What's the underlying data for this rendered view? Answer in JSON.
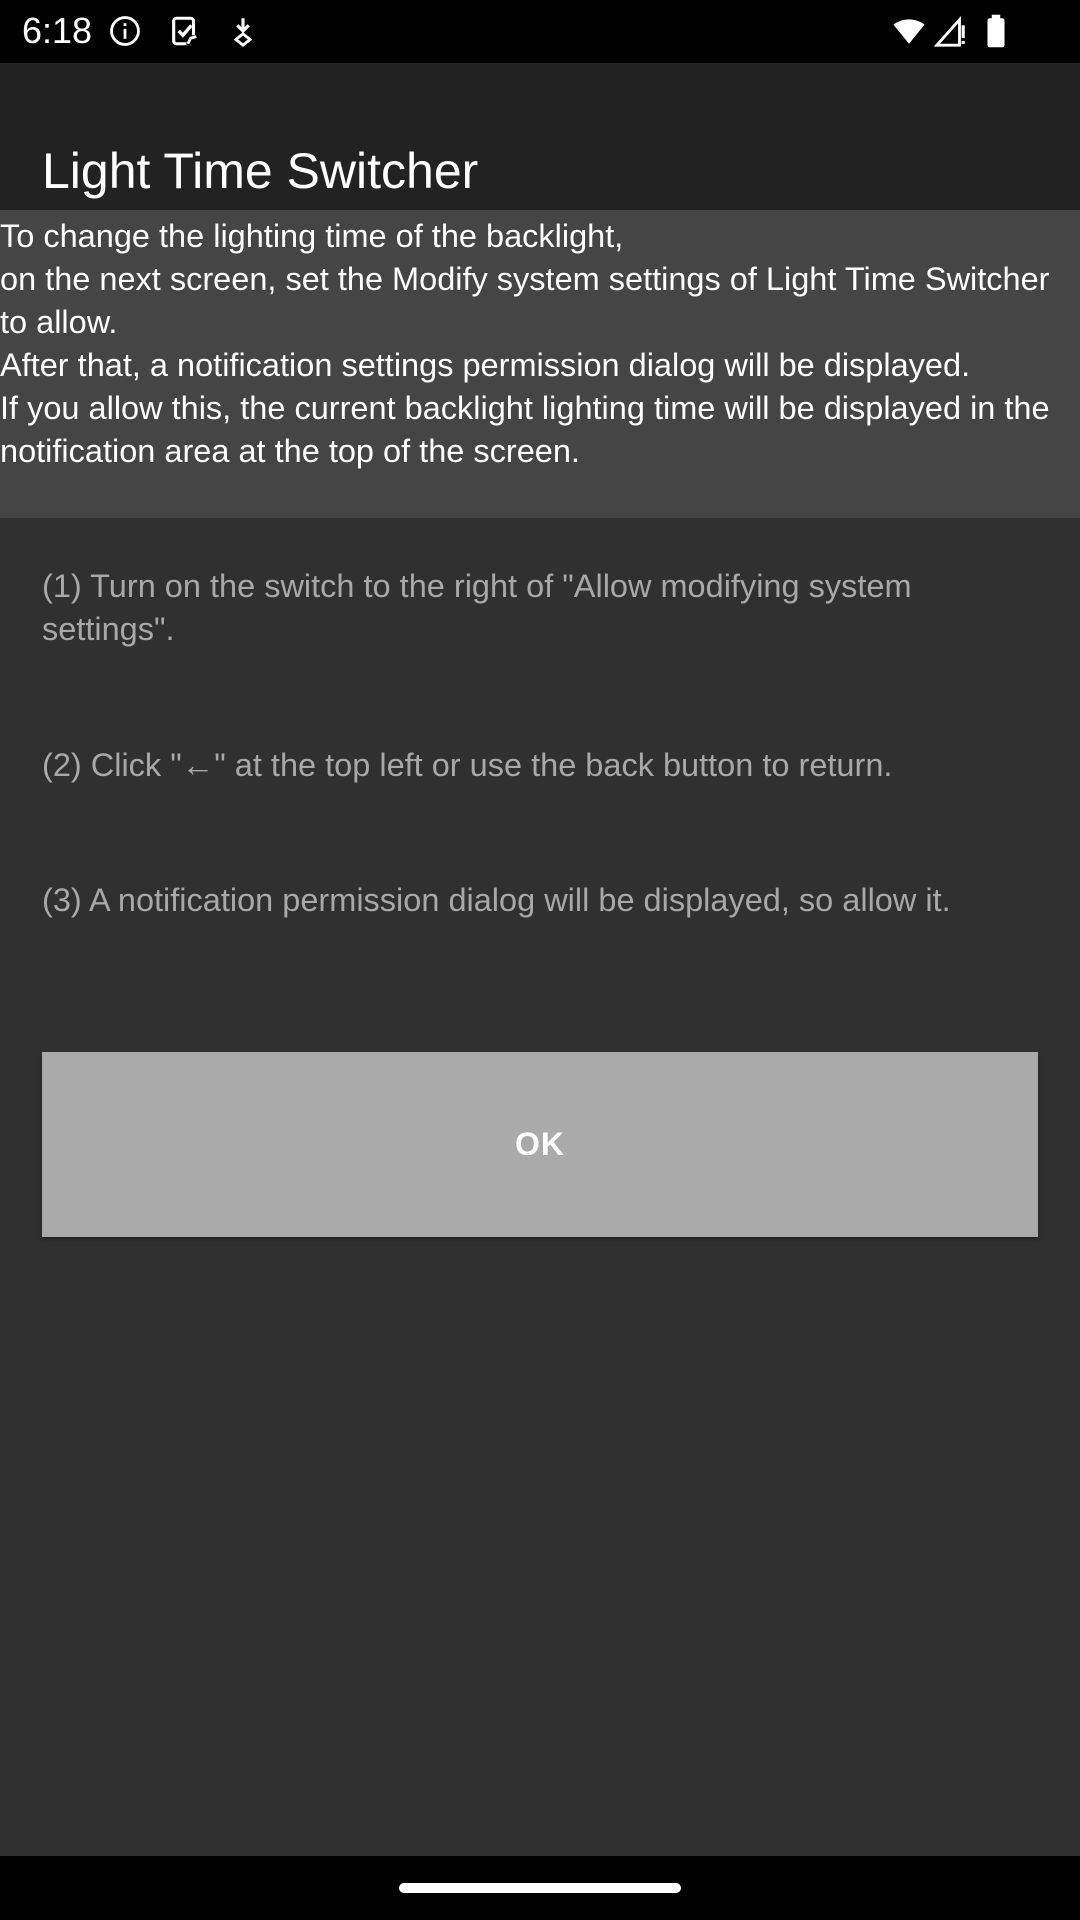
{
  "status_bar": {
    "time": "6:18",
    "icons_left": [
      "info-icon",
      "clipboard-check-icon",
      "download-arrow-icon"
    ],
    "icons_right": [
      "wifi-icon",
      "signal-icon",
      "battery-icon"
    ]
  },
  "app_bar": {
    "title": "Light Time Switcher"
  },
  "intro": {
    "text": "To change the lighting time of the backlight,\non the next screen, set the Modify system settings of Light Time Switcher to allow.\nAfter that, a notification settings permission dialog will be displayed.\nIf you allow this, the current backlight lighting time will be displayed in the notification area at the top of the screen."
  },
  "steps": [
    "(1) Turn on the switch to the right of \"Allow modifying system settings\".",
    "(2) Click \"←\" at the top left or use the back button to return.",
    "(3) A notification permission dialog will be displayed, so allow it."
  ],
  "button": {
    "ok_label": "OK"
  },
  "colors": {
    "background": "#303030",
    "app_bar": "#222222",
    "intro_box": "#454545",
    "step_text": "#a8a8a8",
    "button": "#aaaaaa"
  }
}
